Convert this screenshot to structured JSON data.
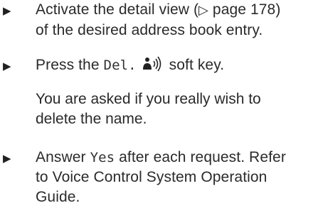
{
  "bullet_glyph": "▶",
  "steps": [
    {
      "line1_pre": "Activate the detail view (",
      "page_ref_glyph": "▷",
      "line1_post": " page 178)",
      "line2": "of the desired address book entry."
    },
    {
      "pre": "Press the ",
      "softkey": "Del.",
      "post": " soft key.",
      "softkey_icon": "voice-speaker-icon"
    },
    {
      "result_line1": "You are asked if you really wish to",
      "result_line2": "delete the name."
    },
    {
      "pre": "Answer ",
      "answer": "Yes",
      "post": " after each request. Refer",
      "line2": "to Voice Control System Operation",
      "line3": "Guide."
    }
  ]
}
